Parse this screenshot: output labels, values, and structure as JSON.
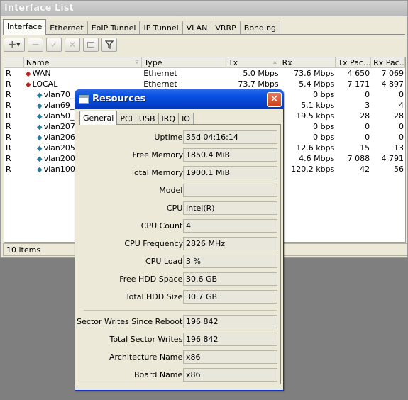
{
  "interface_window": {
    "title": "Interface List",
    "tabs": [
      "Interface",
      "Ethernet",
      "EoIP Tunnel",
      "IP Tunnel",
      "VLAN",
      "VRRP",
      "Bonding"
    ],
    "columns": {
      "name": "Name",
      "type": "Type",
      "tx": "Tx",
      "rx": "Rx",
      "tx_packets": "Tx Pac...",
      "rx_packets": "Rx Pac..."
    },
    "rows": [
      {
        "flag": "R",
        "name": "WAN",
        "type": "Ethernet",
        "tx": "5.0 Mbps",
        "rx": "73.6 Mbps",
        "tx_packets": "4 650",
        "rx_packets": "7 069",
        "kind": "iface"
      },
      {
        "flag": "R",
        "name": "LOCAL",
        "type": "Ethernet",
        "tx": "73.7 Mbps",
        "rx": "5.4 Mbps",
        "tx_packets": "7 171",
        "rx_packets": "4 897",
        "kind": "iface"
      },
      {
        "flag": "R",
        "name": "vlan70_",
        "type": "",
        "tx": "",
        "rx": "0 bps",
        "tx_packets": "0",
        "rx_packets": "0",
        "kind": "vlan"
      },
      {
        "flag": "R",
        "name": "vlan69_",
        "type": "",
        "tx": "",
        "rx": "5.1 kbps",
        "tx_packets": "3",
        "rx_packets": "4",
        "kind": "vlan"
      },
      {
        "flag": "R",
        "name": "vlan50_",
        "type": "",
        "tx": "",
        "rx": "19.5 kbps",
        "tx_packets": "28",
        "rx_packets": "28",
        "kind": "vlan"
      },
      {
        "flag": "R",
        "name": "vlan207",
        "type": "",
        "tx": "",
        "rx": "0 bps",
        "tx_packets": "0",
        "rx_packets": "0",
        "kind": "vlan"
      },
      {
        "flag": "R",
        "name": "vlan206",
        "type": "",
        "tx": "",
        "rx": "0 bps",
        "tx_packets": "0",
        "rx_packets": "0",
        "kind": "vlan"
      },
      {
        "flag": "R",
        "name": "vlan205",
        "type": "",
        "tx": "",
        "rx": "12.6 kbps",
        "tx_packets": "15",
        "rx_packets": "13",
        "kind": "vlan"
      },
      {
        "flag": "R",
        "name": "vlan200",
        "type": "",
        "tx": "",
        "rx": "4.6 Mbps",
        "tx_packets": "7 088",
        "rx_packets": "4 791",
        "kind": "vlan"
      },
      {
        "flag": "R",
        "name": "vlan100",
        "type": "",
        "tx": "",
        "rx": "120.2 kbps",
        "tx_packets": "42",
        "rx_packets": "56",
        "kind": "vlan"
      }
    ],
    "status": "10 items"
  },
  "resources_window": {
    "title": "Resources",
    "close_glyph": "✕",
    "tabs": [
      "General",
      "PCI",
      "USB",
      "IRQ",
      "IO"
    ],
    "fields": [
      {
        "label": "Uptime:",
        "value": "35d 04:16:14"
      },
      {
        "label": "Free Memory:",
        "value": "1850.4 MiB"
      },
      {
        "label": "Total Memory:",
        "value": "1900.1 MiB"
      },
      {
        "label": "Model:",
        "value": ""
      },
      {
        "label": "CPU:",
        "value": "Intel(R)"
      },
      {
        "label": "CPU Count:",
        "value": "4"
      },
      {
        "label": "CPU Frequency:",
        "value": "2826 MHz"
      },
      {
        "label": "CPU Load:",
        "value": "3 %"
      },
      {
        "label": "Free HDD Space:",
        "value": "30.6 GB"
      },
      {
        "label": "Total HDD Size:",
        "value": "30.7 GB"
      },
      {
        "label": "Sector Writes Since Reboot:",
        "value": "196 842"
      },
      {
        "label": "Total Sector Writes:",
        "value": "196 842"
      },
      {
        "label": "Architecture Name:",
        "value": "x86"
      },
      {
        "label": "Board Name:",
        "value": "x86"
      }
    ]
  },
  "toolbar_icons": [
    "add-icon",
    "remove-icon",
    "enable-icon",
    "disable-icon",
    "comment-icon",
    "filter-icon"
  ],
  "colors": {
    "xp_blue": "#0542cf",
    "close_red": "#c8411e",
    "window_bg": "#ece9d8"
  }
}
